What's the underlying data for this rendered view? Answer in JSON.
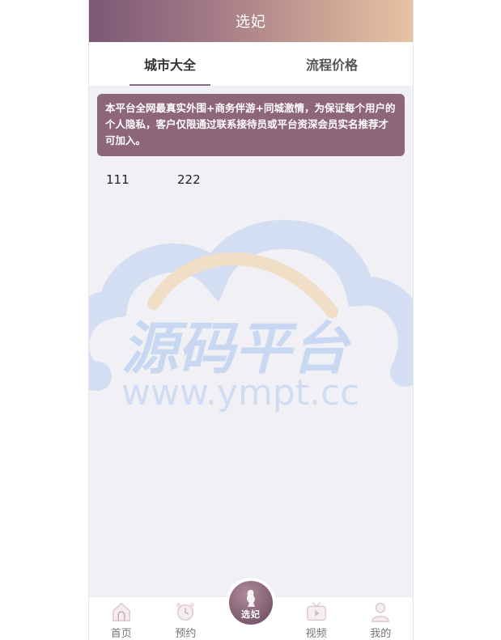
{
  "header": {
    "title": "选妃"
  },
  "tabs": [
    {
      "label": "城市大全",
      "active": true
    },
    {
      "label": "流程价格",
      "active": false
    }
  ],
  "notice": {
    "text": "本平台全网最真实外围+商务伴游+同城激情，为保证每个用户的个人隐私，客户仅限通过联系接待员或平台资深会员实名推荐才可加入。"
  },
  "cities": [
    "111",
    "222"
  ],
  "watermark": {
    "title": "源码平台",
    "url": "www.ympt.cc"
  },
  "tabbar": {
    "home": "首页",
    "booking": "预约",
    "center": "选妃",
    "video": "视频",
    "mine": "我的"
  },
  "colors": {
    "accent": "#8e6679",
    "header_start": "#7d5777",
    "header_end": "#e7c3a3"
  }
}
